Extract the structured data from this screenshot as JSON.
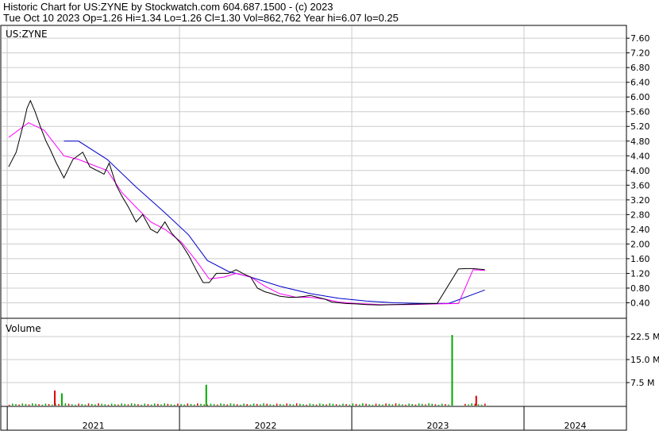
{
  "header": {
    "line1": "Historic Chart for US:ZYNE  by Stockwatch.com 604.687.1500 - (c) 2023",
    "line2": "Tue Oct 10 2023  Op=1.26  Hi=1.34  Lo=1.26  Cl=1.30  Vol=862,762  Year hi=6.07  lo=0.25"
  },
  "colors": {
    "price": "#000000",
    "ma_short": "#ff00ff",
    "ma_long": "#0000cc",
    "vol_up": "#00aa00",
    "vol_down": "#dd0000",
    "grid": "#cccccc",
    "frame": "#000000"
  },
  "chart_data": [
    {
      "type": "line",
      "panel": "price",
      "label": "US:ZYNE",
      "ylim": [
        0,
        8
      ],
      "y_ticks": [
        "7.60",
        "7.20",
        "6.80",
        "6.40",
        "6.00",
        "5.60",
        "5.20",
        "4.80",
        "4.40",
        "4.00",
        "3.60",
        "3.20",
        "2.80",
        "2.40",
        "2.00",
        "1.60",
        "1.20",
        "0.80",
        "0.40"
      ],
      "x_ticks": [
        "2021",
        "2022",
        "2023",
        "2024"
      ],
      "grid": true,
      "series": [
        {
          "key": "close",
          "x": [
            "2021-01-04",
            "2021-01-20",
            "2021-02-05",
            "2021-02-12",
            "2021-02-19",
            "2021-03-01",
            "2021-03-12",
            "2021-03-24",
            "2021-04-01",
            "2021-04-15",
            "2021-05-01",
            "2021-05-20",
            "2021-06-10",
            "2021-06-25",
            "2021-07-10",
            "2021-07-25",
            "2021-08-05",
            "2021-08-20",
            "2021-09-01",
            "2021-09-15",
            "2021-10-01",
            "2021-10-15",
            "2021-11-01",
            "2021-11-15",
            "2021-12-01",
            "2021-12-15",
            "2022-01-05",
            "2022-01-20",
            "2022-02-05",
            "2022-02-20",
            "2022-03-05",
            "2022-03-20",
            "2022-04-05",
            "2022-04-15",
            "2022-05-01",
            "2022-05-15",
            "2022-06-01",
            "2022-06-15",
            "2022-07-01",
            "2022-07-15",
            "2022-08-01",
            "2022-08-20",
            "2022-09-05",
            "2022-09-20",
            "2022-10-05",
            "2022-10-20",
            "2022-11-05",
            "2022-11-20",
            "2022-12-05",
            "2022-12-20",
            "2023-01-10",
            "2023-02-01",
            "2023-03-01",
            "2023-04-01",
            "2023-05-01",
            "2023-06-01",
            "2023-07-01",
            "2023-08-15",
            "2023-09-01",
            "2023-09-15",
            "2023-10-10"
          ],
          "values": [
            4.1,
            4.5,
            5.3,
            5.7,
            5.9,
            5.6,
            5.2,
            4.8,
            4.6,
            4.2,
            3.8,
            4.3,
            4.5,
            4.1,
            4.0,
            3.9,
            4.2,
            3.6,
            3.3,
            3.0,
            2.6,
            2.8,
            2.4,
            2.3,
            2.6,
            2.3,
            2.0,
            1.7,
            1.3,
            0.95,
            0.95,
            1.2,
            1.2,
            1.2,
            1.3,
            1.2,
            1.1,
            0.8,
            0.7,
            0.65,
            0.58,
            0.55,
            0.55,
            0.57,
            0.6,
            0.55,
            0.5,
            0.42,
            0.4,
            0.38,
            0.37,
            0.35,
            0.34,
            0.35,
            0.36,
            0.37,
            0.38,
            1.32,
            1.33,
            1.33,
            1.3
          ]
        },
        {
          "key": "ma_short",
          "x": [
            "2021-01-04",
            "2021-02-15",
            "2021-03-20",
            "2021-05-01",
            "2021-06-01",
            "2021-07-01",
            "2021-08-01",
            "2021-09-01",
            "2021-10-01",
            "2021-11-01",
            "2021-12-01",
            "2022-01-05",
            "2022-02-05",
            "2022-03-05",
            "2022-04-05",
            "2022-05-01",
            "2022-06-01",
            "2022-07-01",
            "2022-08-01",
            "2022-09-05",
            "2022-10-05",
            "2022-11-05",
            "2022-12-05",
            "2023-01-10",
            "2023-03-01",
            "2023-05-01",
            "2023-07-01",
            "2023-08-15",
            "2023-09-15",
            "2023-10-10"
          ],
          "values": [
            4.9,
            5.3,
            5.1,
            4.4,
            4.3,
            4.15,
            4.0,
            3.4,
            3.0,
            2.6,
            2.4,
            2.05,
            1.55,
            1.05,
            1.1,
            1.2,
            1.1,
            0.85,
            0.65,
            0.55,
            0.55,
            0.5,
            0.42,
            0.38,
            0.35,
            0.35,
            0.37,
            0.38,
            1.3,
            1.28
          ]
        },
        {
          "key": "ma_long",
          "x": [
            "2021-05-01",
            "2021-06-01",
            "2021-08-01",
            "2021-10-01",
            "2021-12-01",
            "2022-01-20",
            "2022-03-01",
            "2022-04-15",
            "2022-06-01",
            "2022-08-01",
            "2022-10-05",
            "2022-12-05",
            "2023-02-01",
            "2023-04-01",
            "2023-06-01",
            "2023-07-25",
            "2023-10-10"
          ],
          "values": [
            4.8,
            4.8,
            4.3,
            3.55,
            2.85,
            2.25,
            1.55,
            1.25,
            1.1,
            0.85,
            0.65,
            0.52,
            0.45,
            0.4,
            0.38,
            0.38,
            0.75
          ]
        }
      ]
    },
    {
      "type": "bar",
      "panel": "volume",
      "label": "Volume",
      "ylim": [
        0,
        25
      ],
      "y_ticks": [
        "22.5 M",
        "15.0 M",
        "7.5 M"
      ],
      "grid": true,
      "notable_bars": [
        {
          "x": "2021-04-10",
          "value": 4.9,
          "color": "vol_down"
        },
        {
          "x": "2021-04-25",
          "value": 4.0,
          "color": "vol_up"
        },
        {
          "x": "2022-02-25",
          "value": 6.8,
          "color": "vol_up"
        },
        {
          "x": "2023-07-31",
          "value": 23.0,
          "color": "vol_up"
        },
        {
          "x": "2023-09-20",
          "value": 3.2,
          "color": "vol_down"
        }
      ],
      "baseline_volume_millions": 0.5
    }
  ]
}
